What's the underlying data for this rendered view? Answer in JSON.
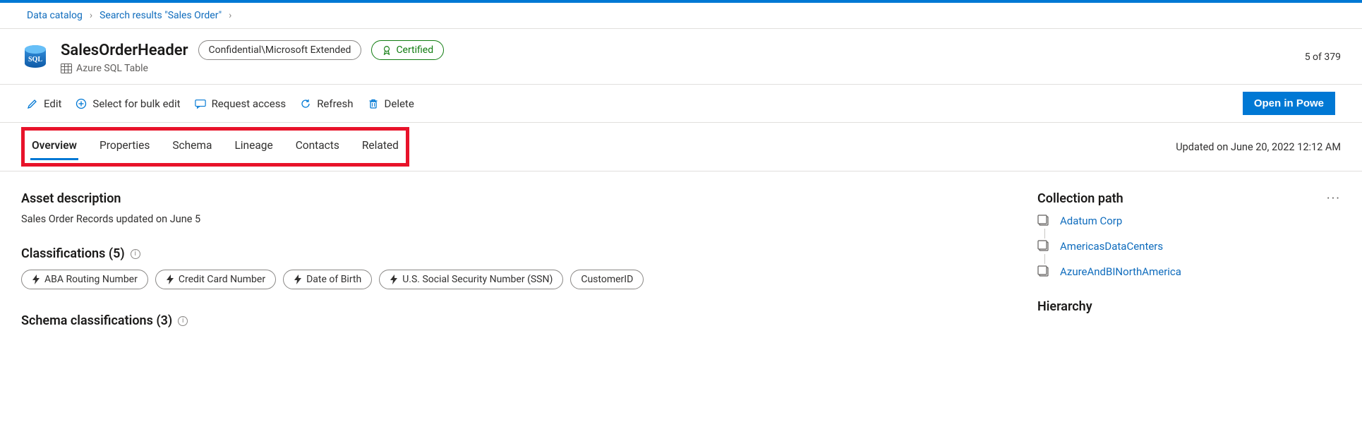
{
  "breadcrumb": {
    "items": [
      "Data catalog",
      "Search results \"Sales Order\""
    ]
  },
  "header": {
    "title": "SalesOrderHeader",
    "classification_pill": "Confidential\\Microsoft Extended",
    "certified_pill": "Certified",
    "subtitle": "Azure SQL Table",
    "count": "5 of 379"
  },
  "toolbar": {
    "edit": "Edit",
    "select_bulk": "Select for bulk edit",
    "request_access": "Request access",
    "refresh": "Refresh",
    "delete": "Delete",
    "open_powerbi": "Open in Powe"
  },
  "tabs": {
    "items": [
      "Overview",
      "Properties",
      "Schema",
      "Lineage",
      "Contacts",
      "Related"
    ],
    "active_index": 0,
    "updated": "Updated on June 20, 2022 12:12 AM"
  },
  "overview": {
    "description_heading": "Asset description",
    "description_text": "Sales Order Records updated on June 5",
    "classifications_heading": "Classifications",
    "classifications_count": "(5)",
    "classifications": [
      {
        "label": "ABA Routing Number",
        "bolt": true
      },
      {
        "label": "Credit Card Number",
        "bolt": true
      },
      {
        "label": "Date of Birth",
        "bolt": true
      },
      {
        "label": "U.S. Social Security Number (SSN)",
        "bolt": true
      },
      {
        "label": "CustomerID",
        "bolt": false
      }
    ],
    "schema_class_heading": "Schema classifications",
    "schema_class_count": "(3)"
  },
  "right": {
    "collection_path_heading": "Collection path",
    "collection_path": [
      "Adatum Corp",
      "AmericasDataCenters",
      "AzureAndBINorthAmerica"
    ],
    "hierarchy_heading": "Hierarchy"
  }
}
